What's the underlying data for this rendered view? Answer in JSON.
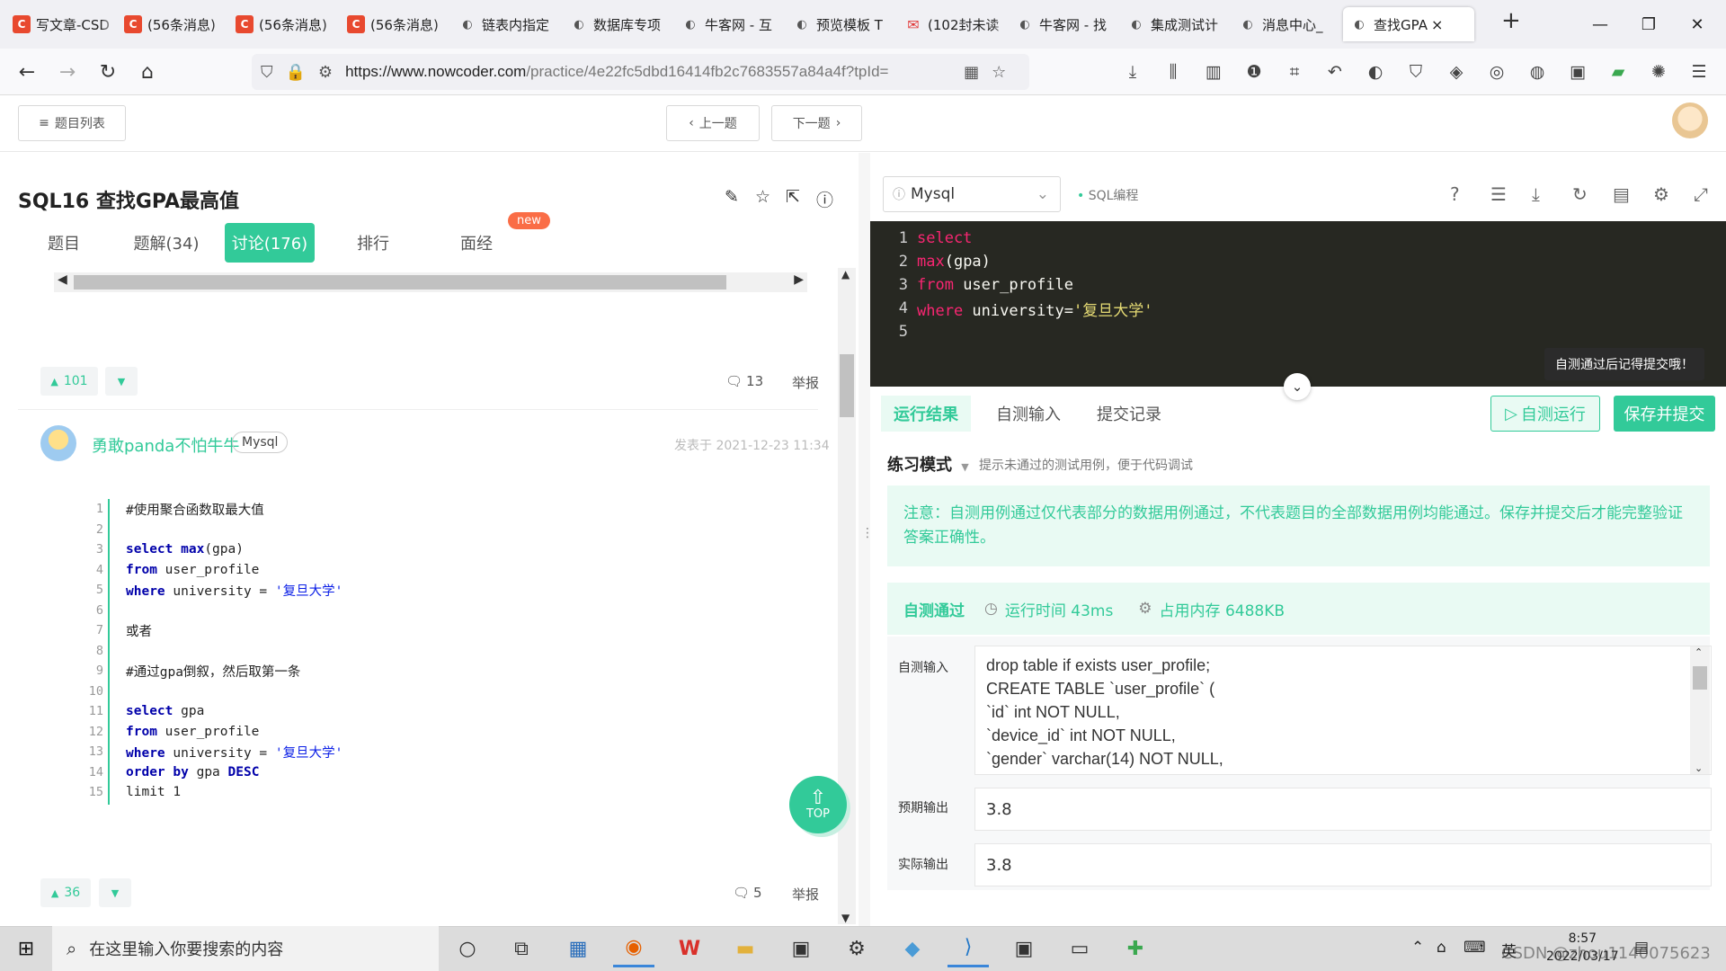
{
  "browser": {
    "tabs": [
      {
        "label": "写文章-CSDN",
        "icon": "csdn"
      },
      {
        "label": "(56条消息)",
        "icon": "csdn"
      },
      {
        "label": "(56条消息)",
        "icon": "csdn"
      },
      {
        "label": "(56条消息)",
        "icon": "csdn"
      },
      {
        "label": "链表内指定",
        "icon": "nowcoder"
      },
      {
        "label": "数据库专项",
        "icon": "nowcoder"
      },
      {
        "label": "牛客网 - 互",
        "icon": "nowcoder"
      },
      {
        "label": "预览模板 T",
        "icon": "nowcoder"
      },
      {
        "label": "(102封未读",
        "icon": "mail"
      },
      {
        "label": "牛客网 - 找",
        "icon": "nowcoder"
      },
      {
        "label": "集成测试计",
        "icon": "nowcoder"
      },
      {
        "label": "消息中心_",
        "icon": "nowcoder"
      },
      {
        "label": "查找GPA",
        "icon": "nowcoder",
        "active": true
      }
    ],
    "url_host": "https://www.nowcoder.com",
    "url_path": "/practice/4e22fc5dbd16414fb2c7683557a84a4f?tpId="
  },
  "header": {
    "question_list": "题目列表",
    "prev": "上一题",
    "next": "下一题"
  },
  "problem": {
    "title": "SQL16  查找GPA最高值",
    "tabs": [
      "题目",
      "题解(34)",
      "讨论(176)",
      "排行",
      "面经"
    ],
    "new_badge": "new"
  },
  "posts": {
    "first_votes": "101",
    "first_comments": "13",
    "report": "举报",
    "author": "勇敢panda不怕牛牛",
    "lang_tag": "Mysql",
    "posted_at": "发表于 2021-12-23 11:34",
    "code_lines": [
      "#使用聚合函数取最大值",
      "",
      "select max(gpa)",
      "from user_profile",
      "where university = '复旦大学'",
      "",
      "或者",
      "",
      "#通过gpa倒叙，然后取第一条",
      "",
      "select gpa",
      "from user_profile",
      "where university = '复旦大学'",
      "order by gpa DESC",
      "limit 1"
    ],
    "line_numbers": [
      "1",
      "2",
      "3",
      "4",
      "5",
      "6",
      "7",
      "8",
      "9",
      "10",
      "11",
      "12",
      "13",
      "14",
      "15"
    ],
    "second_votes": "36",
    "second_comments": "5",
    "top_label": "TOP"
  },
  "editor": {
    "language": "Mysql",
    "mode_tag": "SQL编程",
    "line_numbers": [
      "1",
      "2",
      "3",
      "4",
      "5"
    ],
    "tooltip": "自测通过后记得提交哦！"
  },
  "result": {
    "tabs": [
      "运行结果",
      "自测输入",
      "提交记录"
    ],
    "self_test_button": "自测运行",
    "submit_button": "保存并提交",
    "mode_label": "练习模式",
    "mode_hint": "提示未通过的测试用例，便于代码调试",
    "note": "注意：自测用例通过仅代表部分的数据用例通过，不代表题目的全部数据用例均能通过。保存并提交后才能完整验证答案正确性。",
    "status": "自测通过",
    "run_time": "运行时间 43ms",
    "memory": "占用内存 6488KB",
    "input_label": "自测输入",
    "input_lines": [
      "drop table if exists user_profile;",
      "CREATE TABLE `user_profile` (",
      "`id` int NOT NULL,",
      "`device_id` int NOT NULL,",
      "`gender` varchar(14) NOT NULL,"
    ],
    "expected_label": "预期输出",
    "expected_value": "3.8",
    "actual_label": "实际输出",
    "actual_value": "3.8"
  },
  "taskbar": {
    "search_placeholder": "在这里输入你要搜索的内容",
    "ime": "英",
    "time": "8:57",
    "date": "2022/03/17",
    "watermark": "CSDN @zhou1140075623"
  }
}
